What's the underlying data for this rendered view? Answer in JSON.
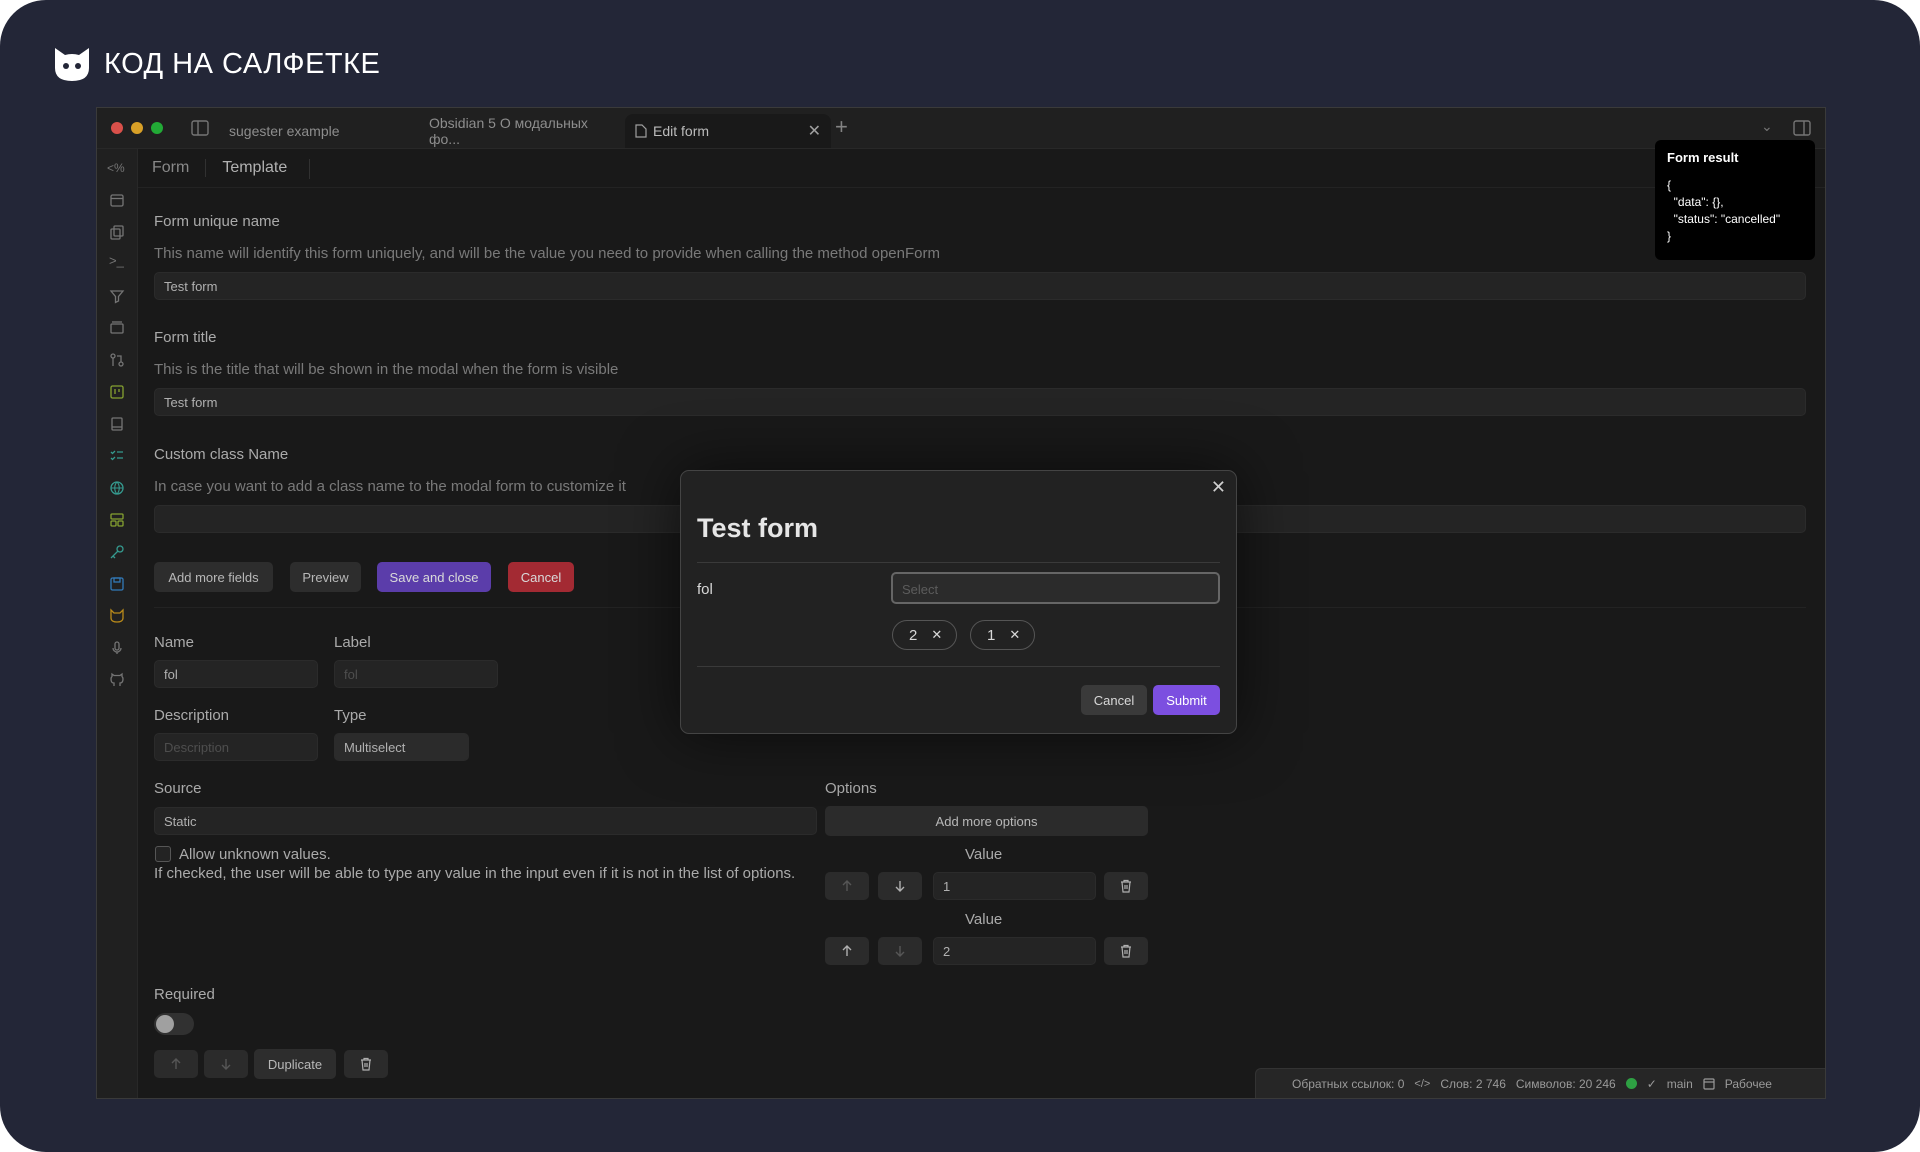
{
  "brand": {
    "name": "КОД НА САЛФЕТКЕ",
    "logo_icon": "cat-head-icon"
  },
  "colors": {
    "frame_bg": "#232637",
    "accent_purple": "#6b48c8",
    "danger_red": "#c0323d",
    "submit_purple": "#7c4fe0"
  },
  "tabs": [
    {
      "label": "sugester example"
    },
    {
      "label": "Obsidian 5 О модальных фо..."
    },
    {
      "label": "Edit form"
    }
  ],
  "subtabs": {
    "form": "Form",
    "template": "Template"
  },
  "form": {
    "unique_name_label": "Form unique name",
    "unique_name_desc": "This name will identify this form uniquely, and will be the value you need to provide when calling the method openForm",
    "unique_name_value": "Test form",
    "title_label": "Form title",
    "title_desc": "This is the title that will be shown in the modal when the form is visible",
    "title_value": "Test form",
    "class_label": "Custom class Name",
    "class_desc": "In case you want to add a class name to the modal form to customize it",
    "class_value": ""
  },
  "actions": {
    "add_fields": "Add more fields",
    "preview": "Preview",
    "save_close": "Save and close",
    "cancel": "Cancel"
  },
  "field": {
    "name_label": "Name",
    "name_value": "fol",
    "label_label": "Label",
    "label_placeholder": "fol",
    "description_label": "Description",
    "description_placeholder": "Description",
    "type_label": "Type",
    "type_value": "Multiselect",
    "source_label": "Source",
    "source_value": "Static",
    "allow_unknown": "Allow unknown values.",
    "allow_unknown_desc": "If checked, the user will be able to type any value in the input even if it is not in the list of options.",
    "options_label": "Options",
    "add_options": "Add more options",
    "options": [
      {
        "label": "Value",
        "value": "1"
      },
      {
        "label": "Value",
        "value": "2"
      }
    ],
    "required_label": "Required",
    "duplicate": "Duplicate"
  },
  "tooltip": {
    "title": "Form result",
    "body": "{\n  \"data\": {},\n  \"status\": \"cancelled\"\n}"
  },
  "modal": {
    "title": "Test form",
    "field_label": "fol",
    "select_placeholder": "Select",
    "chips": [
      "2",
      "1"
    ],
    "cancel": "Cancel",
    "submit": "Submit"
  },
  "statusbar": {
    "backlinks": "Обратных ссылок: 0",
    "words": "Слов: 2 746",
    "chars": "Символов: 20 246",
    "branch": "main",
    "workspace": "Рабочее"
  }
}
